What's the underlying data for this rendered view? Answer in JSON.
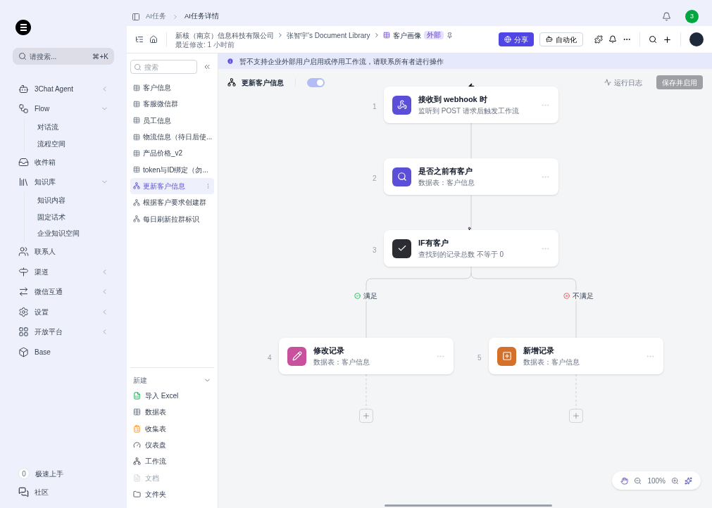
{
  "sidebar": {
    "search": {
      "placeholder": "请搜索...",
      "shortcut": "⌘+K"
    },
    "nav": [
      {
        "label": "3Chat Agent",
        "kind": "group",
        "expanded": false
      },
      {
        "label": "Flow",
        "kind": "group",
        "expanded": true,
        "children": [
          {
            "label": "对话流"
          },
          {
            "label": "流程空间"
          }
        ]
      },
      {
        "label": "收件箱",
        "kind": "link"
      },
      {
        "label": "知识库",
        "kind": "group",
        "expanded": true,
        "children": [
          {
            "label": "知识内容"
          },
          {
            "label": "固定话术"
          },
          {
            "label": "企业知识空间"
          }
        ]
      },
      {
        "label": "联系人",
        "kind": "link"
      },
      {
        "label": "渠道",
        "kind": "group",
        "expanded": false
      },
      {
        "label": "微信互通",
        "kind": "group",
        "expanded": false
      },
      {
        "label": "设置",
        "kind": "group",
        "expanded": false
      },
      {
        "label": "开放平台",
        "kind": "group",
        "expanded": false
      },
      {
        "label": "Base",
        "kind": "link"
      }
    ],
    "bottom": [
      {
        "badge": "0",
        "label": "极速上手"
      },
      {
        "label": "社区"
      }
    ]
  },
  "topbar": {
    "breadcrumbs": [
      "AI任务",
      "AI任务详情"
    ],
    "avatar": "3"
  },
  "doc_header": {
    "path": [
      "新核（南京）信息科技有限公司",
      "张智宇's Document Library"
    ],
    "title": "客户画像",
    "badge": "外部",
    "modified": "最近修改: 1 小时前",
    "share": "分享",
    "automate": "自动化"
  },
  "files": {
    "search": {
      "placeholder": "搜索"
    },
    "items": [
      {
        "label": "客户信息",
        "kind": "table",
        "selected": false
      },
      {
        "label": "客服微信群",
        "kind": "table",
        "selected": false
      },
      {
        "label": "员工信息",
        "kind": "table",
        "selected": false
      },
      {
        "label": "物流信息（待日后使...",
        "kind": "table",
        "selected": false
      },
      {
        "label": "产品价格_v2",
        "kind": "table",
        "selected": false
      },
      {
        "label": "token与ID绑定（勿...",
        "kind": "table",
        "selected": false
      },
      {
        "label": "更新客户信息",
        "kind": "workflow",
        "selected": true
      },
      {
        "label": "根据客户要求创建群",
        "kind": "workflow",
        "selected": false
      },
      {
        "label": "每日刷新拉群标识",
        "kind": "workflow",
        "selected": false
      }
    ],
    "new_section": {
      "title": "新建",
      "expanded": true,
      "items": [
        {
          "label": "导入 Excel",
          "kind": "excel",
          "disabled": false
        },
        {
          "label": "数据表",
          "kind": "table",
          "disabled": false
        },
        {
          "label": "收集表",
          "kind": "form",
          "disabled": false
        },
        {
          "label": "仪表盘",
          "kind": "dashboard",
          "disabled": false
        },
        {
          "label": "工作流",
          "kind": "workflow",
          "disabled": false
        },
        {
          "label": "文档",
          "kind": "doc",
          "disabled": true
        },
        {
          "label": "文件夹",
          "kind": "folder",
          "disabled": false
        }
      ]
    }
  },
  "banner": "暂不支持企业外部用户启用或停用工作流，请联系所有者进行操作",
  "flow": {
    "name": "更新客户信息",
    "enabled": true,
    "run_log": "运行日志",
    "save": {
      "label": "保存并启用",
      "disabled": true
    },
    "nodes": [
      {
        "number": "1",
        "title": "接收到 webhook 时",
        "subtitle": "监听到 POST 请求后触发工作流",
        "kind": "webhook",
        "color": "#5b4fd9"
      },
      {
        "number": "2",
        "title": "是否之前有客户",
        "subtitle": "数据表：客户信息",
        "kind": "search",
        "color": "#5b4fd9"
      },
      {
        "number": "3",
        "title": "IF有客户",
        "subtitle": "查找到的记录总数 不等于 0",
        "kind": "condition",
        "color": "#2b2d33"
      },
      {
        "number": "4",
        "title": "修改记录",
        "subtitle": "数据表：客户信息",
        "kind": "update",
        "color": "#c9509c"
      },
      {
        "number": "5",
        "title": "新增记录",
        "subtitle": "数据表：客户信息",
        "kind": "create",
        "color": "#d5702a"
      }
    ],
    "branches": [
      {
        "label": "满足",
        "kind": "yes"
      },
      {
        "label": "不满足",
        "kind": "no"
      }
    ],
    "zoom": "100%"
  }
}
